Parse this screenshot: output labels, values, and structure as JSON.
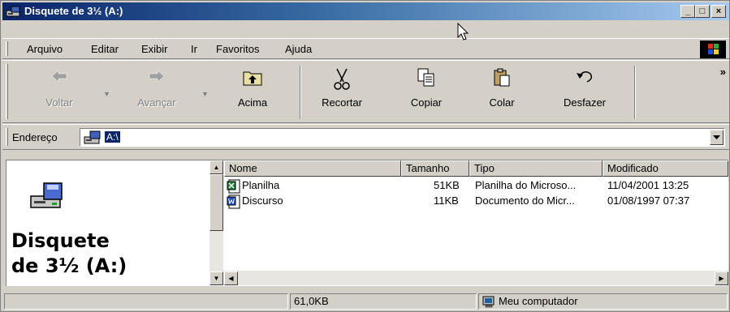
{
  "window": {
    "title": "Disquete de 3½ (A:)",
    "min_symbol": "_",
    "max_symbol": "□",
    "close_symbol": "×"
  },
  "menubar": {
    "items": [
      "Arquivo",
      "Editar",
      "Exibir",
      "Ir",
      "Favoritos",
      "Ajuda"
    ]
  },
  "toolbar": {
    "buttons": [
      {
        "label": "Voltar",
        "icon": "back-arrow-icon",
        "enabled": false
      },
      {
        "label": "Avançar",
        "icon": "forward-arrow-icon",
        "enabled": false
      },
      {
        "label": "Acima",
        "icon": "up-folder-icon",
        "enabled": true
      },
      {
        "label": "Recortar",
        "icon": "scissors-icon",
        "enabled": true
      },
      {
        "label": "Copiar",
        "icon": "copy-icon",
        "enabled": true
      },
      {
        "label": "Colar",
        "icon": "paste-icon",
        "enabled": true
      },
      {
        "label": "Desfazer",
        "icon": "undo-icon",
        "enabled": true
      }
    ],
    "more": "»"
  },
  "address": {
    "label": "Endereço",
    "value": "A:\\"
  },
  "leftpane": {
    "title_line1": "Disquete",
    "title_line2": "de 3½ (A:)"
  },
  "list": {
    "columns": [
      "Nome",
      "Tamanho",
      "Tipo",
      "Modificado"
    ],
    "rows": [
      {
        "name": "Planilha",
        "size": "51KB",
        "type": "Planilha do Microso...",
        "modified": "11/04/2001 13:25",
        "icon": "excel-file-icon"
      },
      {
        "name": "Discurso",
        "size": "11KB",
        "type": "Documento do Micr...",
        "modified": "01/08/1997 07:37",
        "icon": "word-file-icon"
      }
    ]
  },
  "statusbar": {
    "size": "61,0KB",
    "zone": "Meu computador"
  },
  "colors": {
    "titlebar_start": "#0a246a",
    "titlebar_end": "#a6caf0",
    "chrome": "#d4d0c8",
    "selection": "#0a246a"
  }
}
